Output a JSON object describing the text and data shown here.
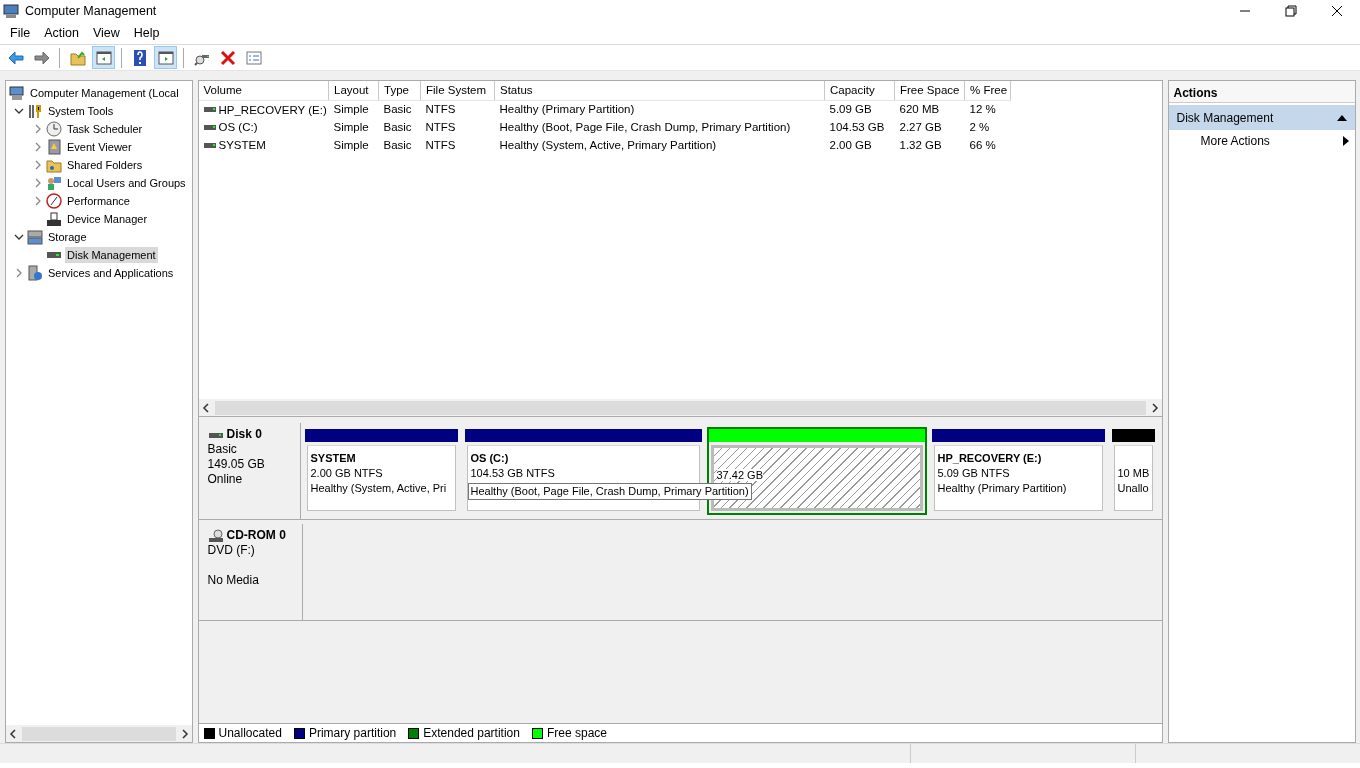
{
  "window": {
    "title": "Computer Management"
  },
  "menu": [
    {
      "label": "File"
    },
    {
      "label": "Action"
    },
    {
      "label": "View"
    },
    {
      "label": "Help"
    }
  ],
  "toolbar": [
    {
      "kind": "back",
      "pressed": false
    },
    {
      "kind": "forward",
      "pressed": false
    },
    {
      "kind": "sep"
    },
    {
      "kind": "up",
      "pressed": false
    },
    {
      "kind": "tree",
      "pressed": true
    },
    {
      "kind": "sep"
    },
    {
      "kind": "help",
      "pressed": false
    },
    {
      "kind": "pane",
      "pressed": true
    },
    {
      "kind": "sep"
    },
    {
      "kind": "connect",
      "pressed": false
    },
    {
      "kind": "delete",
      "pressed": false
    },
    {
      "kind": "properties",
      "pressed": false
    }
  ],
  "tree": [
    {
      "label": "Computer Management (Local",
      "selected": false,
      "children": [
        {
          "label": "System Tools",
          "expanded": true,
          "selected": false,
          "children": [
            {
              "label": "Task Scheduler",
              "expanded": false,
              "selected": false
            },
            {
              "label": "Event Viewer",
              "expanded": false,
              "selected": false
            },
            {
              "label": "Shared Folders",
              "expanded": false,
              "selected": false
            },
            {
              "label": "Local Users and Groups",
              "expanded": false,
              "selected": false
            },
            {
              "label": "Performance",
              "expanded": false,
              "selected": false
            },
            {
              "label": "Device Manager",
              "selected": false
            }
          ]
        },
        {
          "label": "Storage",
          "expanded": true,
          "selected": false,
          "children": [
            {
              "label": "Disk Management",
              "selected": true
            }
          ]
        },
        {
          "label": "Services and Applications",
          "expanded": false,
          "selected": false
        }
      ]
    }
  ],
  "volumes": {
    "columns": [
      "Volume",
      "Layout",
      "Type",
      "File System",
      "Status",
      "Capacity",
      "Free Space",
      "% Free"
    ],
    "rows": [
      [
        "HP_RECOVERY (E:)",
        "Simple",
        "Basic",
        "NTFS",
        "Healthy (Primary Partition)",
        "5.09 GB",
        "620 MB",
        "12 %"
      ],
      [
        "OS (C:)",
        "Simple",
        "Basic",
        "NTFS",
        "Healthy (Boot, Page File, Crash Dump, Primary Partition)",
        "104.53 GB",
        "2.27 GB",
        "2 %"
      ],
      [
        "SYSTEM",
        "Simple",
        "Basic",
        "NTFS",
        "Healthy (System, Active, Primary Partition)",
        "2.00 GB",
        "1.32 GB",
        "66 %"
      ]
    ]
  },
  "disks": [
    {
      "kind": "disk",
      "name": "Disk 0",
      "type": "Basic",
      "size": "149.05 GB",
      "status": "Online",
      "partitions": [
        {
          "kind": "primary",
          "name": "SYSTEM",
          "size": "2.00 GB NTFS",
          "status": "Healthy (System, Active, Pri",
          "selected": false
        },
        {
          "kind": "primary",
          "name": "OS  (C:)",
          "size": "104.53 GB NTFS",
          "selected": false
        },
        {
          "kind": "free",
          "size": "37.42 GB",
          "selected": true
        },
        {
          "kind": "primary",
          "name": "HP_RECOVERY  (E:)",
          "size": "5.09 GB NTFS",
          "status": "Healthy (Primary Partition)",
          "selected": false
        },
        {
          "kind": "unallocated",
          "size": "10 MB",
          "status": "Unallo",
          "selected": false
        }
      ]
    },
    {
      "kind": "cdrom",
      "name": "CD-ROM 0",
      "type": "DVD (F:)",
      "status": "No Media"
    }
  ],
  "tooltip": {
    "text": "Healthy (Boot, Page File, Crash Dump, Primary Partition)"
  },
  "legend": [
    {
      "label": "Unallocated",
      "color": "#000000"
    },
    {
      "label": "Primary partition",
      "color": "#000080"
    },
    {
      "label": "Extended partition",
      "color": "#008000"
    },
    {
      "label": "Free space",
      "color": "#00ff00"
    }
  ],
  "actions": {
    "title": "Actions",
    "sections": [
      {
        "label": "Disk Management",
        "expanded": true,
        "items": [
          {
            "label": "More Actions"
          }
        ]
      }
    ]
  }
}
